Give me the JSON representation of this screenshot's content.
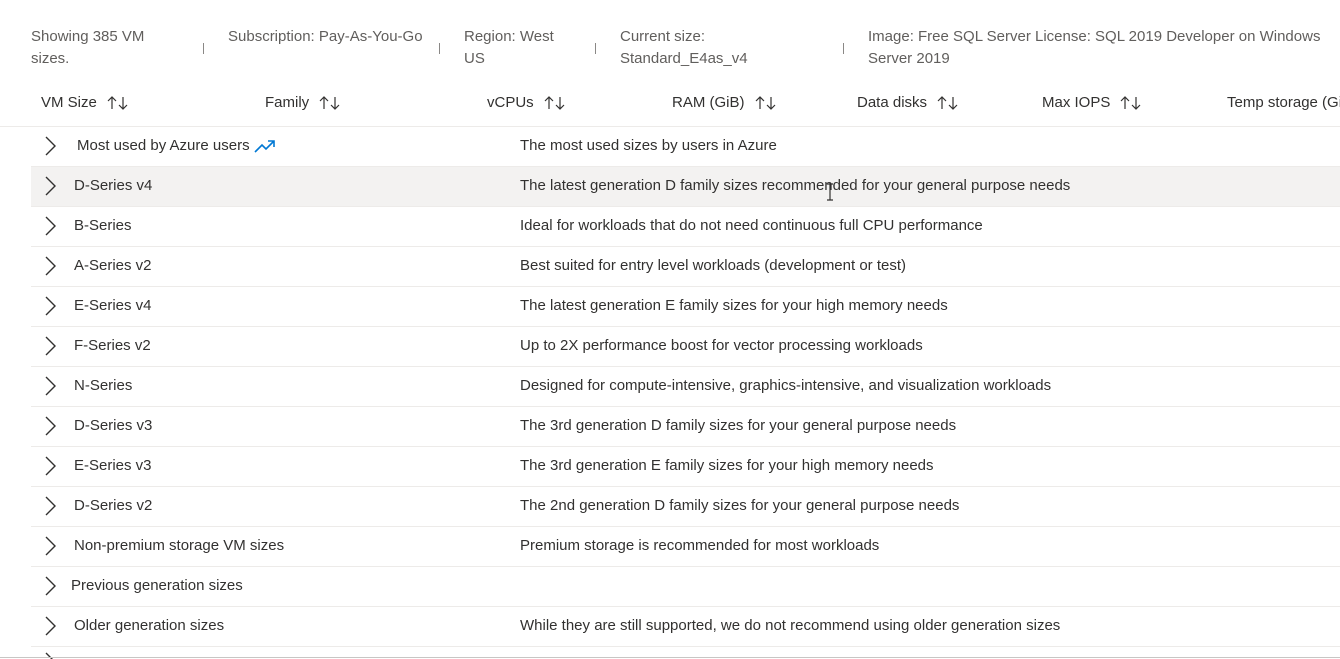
{
  "summary": {
    "showing": "Showing 385 VM sizes.",
    "subscription": "Subscription: Pay-As-You-Go",
    "region": "Region: West US",
    "current_size": "Current size: Standard_E4as_v4",
    "image": "Image: Free SQL Server License: SQL 2019 Developer on Windows Server 2019"
  },
  "columns": [
    {
      "label": "VM Size"
    },
    {
      "label": "Family"
    },
    {
      "label": "vCPUs"
    },
    {
      "label": "RAM (GiB)"
    },
    {
      "label": "Data disks"
    },
    {
      "label": "Max IOPS"
    },
    {
      "label": "Temp storage (GiB)"
    }
  ],
  "groups": [
    {
      "name": "Most used by Azure users",
      "description": "The most used sizes by users in Azure"
    },
    {
      "name": "D-Series v4",
      "description": "The latest generation D family sizes recommended for your general purpose needs"
    },
    {
      "name": "B-Series",
      "description": "Ideal for workloads that do not need continuous full CPU performance"
    },
    {
      "name": "A-Series v2",
      "description": "Best suited for entry level workloads (development or test)"
    },
    {
      "name": "E-Series v4",
      "description": "The latest generation E family sizes for your high memory needs"
    },
    {
      "name": "F-Series v2",
      "description": "Up to 2X performance boost for vector processing workloads"
    },
    {
      "name": "N-Series",
      "description": "Designed for compute-intensive, graphics-intensive, and visualization workloads"
    },
    {
      "name": "D-Series v3",
      "description": "The 3rd generation D family sizes for your general purpose needs"
    },
    {
      "name": "E-Series v3",
      "description": "The 3rd generation E family sizes for your high memory needs"
    },
    {
      "name": "D-Series v2",
      "description": "The 2nd generation D family sizes for your general purpose needs"
    },
    {
      "name": "Non-premium storage VM sizes",
      "description": "Premium storage is recommended for most workloads"
    },
    {
      "name": "Previous generation sizes",
      "description": ""
    },
    {
      "name": "Older generation sizes",
      "description": "While they are still supported, we do not recommend using older generation sizes"
    }
  ],
  "colors": {
    "accent": "#0078d4",
    "border": "#edebe9",
    "hover_row": "#f3f2f1",
    "text": "#323130",
    "muted": "#605e5c"
  }
}
